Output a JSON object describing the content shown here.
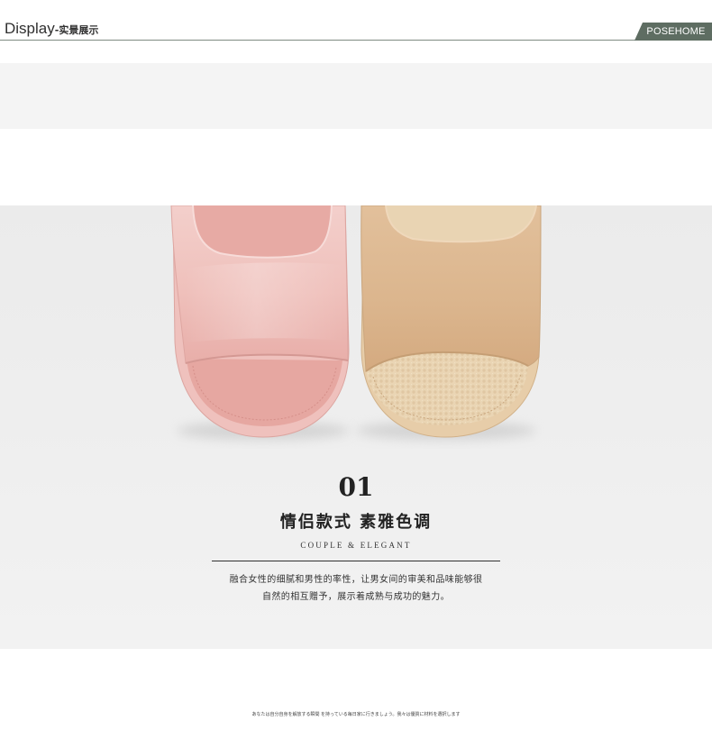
{
  "header": {
    "title": "Display",
    "subtitle": "-实景展示",
    "brand": "POSEHOME"
  },
  "feature": {
    "number": "01",
    "heading": "情侣款式 素雅色调",
    "subheading": "COUPLE & ELEGANT",
    "description_lines": [
      "融合女性的细腻和男性的率性，让男女间的审美和品味能够很",
      "自然的相互赠予，展示着成熟与成功的魅力。"
    ]
  },
  "footer": {
    "note": "あなたは自分自身を解放する瞬間 を持っている毎日家に行きましょう。我々は優質に材料を選択します"
  },
  "colors": {
    "brand_tab": "#5e6d62",
    "header_rule": "#7f8b82",
    "pink_slipper": "#eebdb9",
    "tan_slipper": "#dcb78f"
  }
}
